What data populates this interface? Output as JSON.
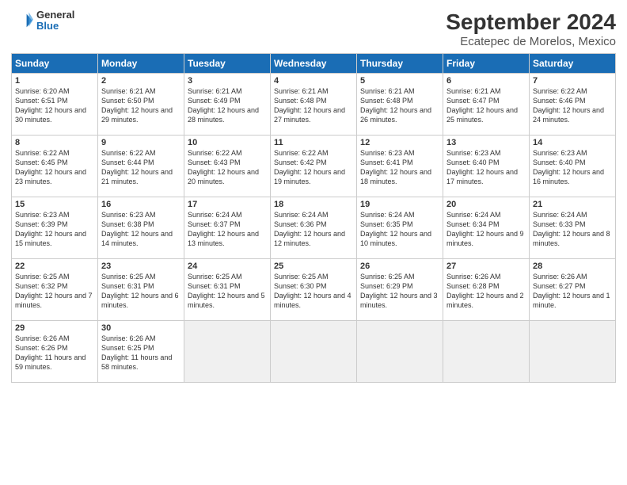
{
  "logo": {
    "general": "General",
    "blue": "Blue"
  },
  "title": "September 2024",
  "subtitle": "Ecatepec de Morelos, Mexico",
  "days_of_week": [
    "Sunday",
    "Monday",
    "Tuesday",
    "Wednesday",
    "Thursday",
    "Friday",
    "Saturday"
  ],
  "weeks": [
    [
      {
        "num": "1",
        "info": "Sunrise: 6:20 AM\nSunset: 6:51 PM\nDaylight: 12 hours\nand 30 minutes."
      },
      {
        "num": "2",
        "info": "Sunrise: 6:21 AM\nSunset: 6:50 PM\nDaylight: 12 hours\nand 29 minutes."
      },
      {
        "num": "3",
        "info": "Sunrise: 6:21 AM\nSunset: 6:49 PM\nDaylight: 12 hours\nand 28 minutes."
      },
      {
        "num": "4",
        "info": "Sunrise: 6:21 AM\nSunset: 6:48 PM\nDaylight: 12 hours\nand 27 minutes."
      },
      {
        "num": "5",
        "info": "Sunrise: 6:21 AM\nSunset: 6:48 PM\nDaylight: 12 hours\nand 26 minutes."
      },
      {
        "num": "6",
        "info": "Sunrise: 6:21 AM\nSunset: 6:47 PM\nDaylight: 12 hours\nand 25 minutes."
      },
      {
        "num": "7",
        "info": "Sunrise: 6:22 AM\nSunset: 6:46 PM\nDaylight: 12 hours\nand 24 minutes."
      }
    ],
    [
      {
        "num": "8",
        "info": "Sunrise: 6:22 AM\nSunset: 6:45 PM\nDaylight: 12 hours\nand 23 minutes."
      },
      {
        "num": "9",
        "info": "Sunrise: 6:22 AM\nSunset: 6:44 PM\nDaylight: 12 hours\nand 21 minutes."
      },
      {
        "num": "10",
        "info": "Sunrise: 6:22 AM\nSunset: 6:43 PM\nDaylight: 12 hours\nand 20 minutes."
      },
      {
        "num": "11",
        "info": "Sunrise: 6:22 AM\nSunset: 6:42 PM\nDaylight: 12 hours\nand 19 minutes."
      },
      {
        "num": "12",
        "info": "Sunrise: 6:23 AM\nSunset: 6:41 PM\nDaylight: 12 hours\nand 18 minutes."
      },
      {
        "num": "13",
        "info": "Sunrise: 6:23 AM\nSunset: 6:40 PM\nDaylight: 12 hours\nand 17 minutes."
      },
      {
        "num": "14",
        "info": "Sunrise: 6:23 AM\nSunset: 6:40 PM\nDaylight: 12 hours\nand 16 minutes."
      }
    ],
    [
      {
        "num": "15",
        "info": "Sunrise: 6:23 AM\nSunset: 6:39 PM\nDaylight: 12 hours\nand 15 minutes."
      },
      {
        "num": "16",
        "info": "Sunrise: 6:23 AM\nSunset: 6:38 PM\nDaylight: 12 hours\nand 14 minutes."
      },
      {
        "num": "17",
        "info": "Sunrise: 6:24 AM\nSunset: 6:37 PM\nDaylight: 12 hours\nand 13 minutes."
      },
      {
        "num": "18",
        "info": "Sunrise: 6:24 AM\nSunset: 6:36 PM\nDaylight: 12 hours\nand 12 minutes."
      },
      {
        "num": "19",
        "info": "Sunrise: 6:24 AM\nSunset: 6:35 PM\nDaylight: 12 hours\nand 10 minutes."
      },
      {
        "num": "20",
        "info": "Sunrise: 6:24 AM\nSunset: 6:34 PM\nDaylight: 12 hours\nand 9 minutes."
      },
      {
        "num": "21",
        "info": "Sunrise: 6:24 AM\nSunset: 6:33 PM\nDaylight: 12 hours\nand 8 minutes."
      }
    ],
    [
      {
        "num": "22",
        "info": "Sunrise: 6:25 AM\nSunset: 6:32 PM\nDaylight: 12 hours\nand 7 minutes."
      },
      {
        "num": "23",
        "info": "Sunrise: 6:25 AM\nSunset: 6:31 PM\nDaylight: 12 hours\nand 6 minutes."
      },
      {
        "num": "24",
        "info": "Sunrise: 6:25 AM\nSunset: 6:31 PM\nDaylight: 12 hours\nand 5 minutes."
      },
      {
        "num": "25",
        "info": "Sunrise: 6:25 AM\nSunset: 6:30 PM\nDaylight: 12 hours\nand 4 minutes."
      },
      {
        "num": "26",
        "info": "Sunrise: 6:25 AM\nSunset: 6:29 PM\nDaylight: 12 hours\nand 3 minutes."
      },
      {
        "num": "27",
        "info": "Sunrise: 6:26 AM\nSunset: 6:28 PM\nDaylight: 12 hours\nand 2 minutes."
      },
      {
        "num": "28",
        "info": "Sunrise: 6:26 AM\nSunset: 6:27 PM\nDaylight: 12 hours\nand 1 minute."
      }
    ],
    [
      {
        "num": "29",
        "info": "Sunrise: 6:26 AM\nSunset: 6:26 PM\nDaylight: 11 hours\nand 59 minutes."
      },
      {
        "num": "30",
        "info": "Sunrise: 6:26 AM\nSunset: 6:25 PM\nDaylight: 11 hours\nand 58 minutes."
      },
      {
        "num": "",
        "info": "",
        "empty": true
      },
      {
        "num": "",
        "info": "",
        "empty": true
      },
      {
        "num": "",
        "info": "",
        "empty": true
      },
      {
        "num": "",
        "info": "",
        "empty": true
      },
      {
        "num": "",
        "info": "",
        "empty": true
      }
    ]
  ]
}
